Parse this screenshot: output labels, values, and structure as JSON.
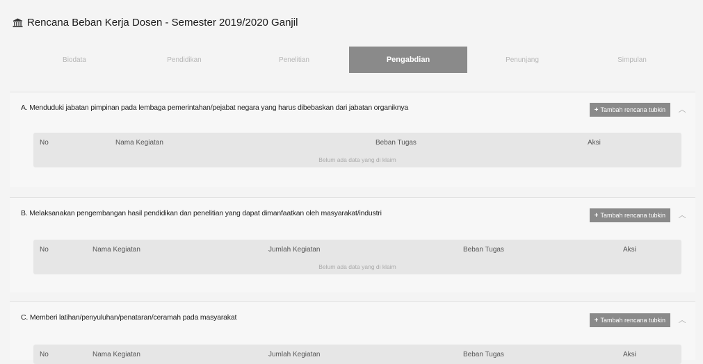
{
  "header": {
    "icon": "institution-icon",
    "title": "Rencana Beban Kerja Dosen - Semester 2019/2020 Ganjil"
  },
  "tabs": [
    {
      "label": "Biodata"
    },
    {
      "label": "Pendidikan"
    },
    {
      "label": "Penelitian"
    },
    {
      "label": "Pengabdian",
      "active": true
    },
    {
      "label": "Penunjang"
    },
    {
      "label": "Simpulan"
    }
  ],
  "sections": [
    {
      "title": "A. Menduduki jabatan pimpinan pada lembaga pemerintahan/pejabat negara yang harus dibebaskan dari jabatan organiknya",
      "add_button": "Tambah rencana tubkin",
      "columns": [
        "No",
        "Nama Kegiatan",
        "Beban Tugas",
        "Aksi"
      ],
      "empty": "Belum ada data yang di klaim"
    },
    {
      "title": "B. Melaksanakan pengembangan hasil pendidikan dan penelitian yang dapat dimanfaatkan oleh masyarakat/industri",
      "add_button": "Tambah rencana tubkin",
      "columns": [
        "No",
        "Nama Kegiatan",
        "Jumlah Kegiatan",
        "Beban Tugas",
        "Aksi"
      ],
      "empty": "Belum ada data yang di klaim"
    },
    {
      "title": "C. Memberi latihan/penyuluhan/penataran/ceramah pada masyarakat",
      "add_button": "Tambah rencana tubkin",
      "columns": [
        "No",
        "Nama Kegiatan",
        "Jumlah Kegiatan",
        "Beban Tugas",
        "Aksi"
      ]
    }
  ],
  "colors": {
    "active_tab": "#8a8a8a",
    "button": "#8a8a8a",
    "table_bg": "#e6e6e6",
    "page_bg": "#f4f4f4"
  }
}
